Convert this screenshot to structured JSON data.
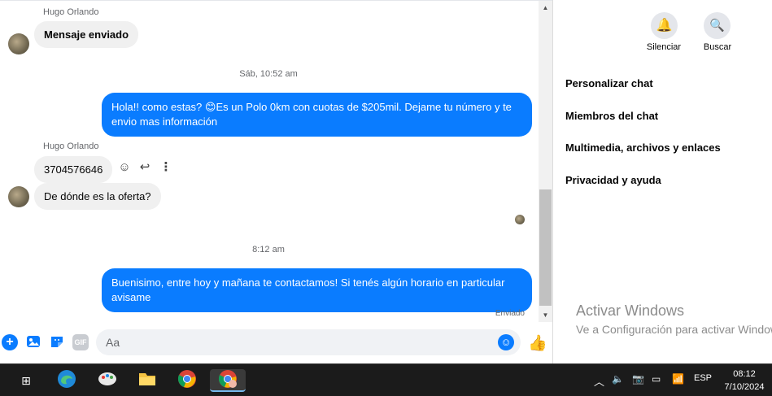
{
  "chat": {
    "sender_top": "Hugo Orlando",
    "msg_enviado": "Mensaje enviado",
    "time1": "Sáb, 10:52 am",
    "out1": "Hola!! como estas? 😊Es un Polo 0km con cuotas de $205mil. Dejame tu número y te envio mas información",
    "sender_mid": "Hugo Orlando",
    "in_number": "3704576646",
    "in_question": "De dónde es la oferta?",
    "time2": "8:12 am",
    "out2": "Buenisimo, entre hoy y mañana te contactamos! Si tenés algún horario en particular avisame",
    "status": "Enviado"
  },
  "composer": {
    "placeholder": "Aa",
    "tools": [
      "plus-icon",
      "image-icon",
      "sticker-icon",
      "gif-icon"
    ]
  },
  "side": {
    "silence": "Silenciar",
    "search": "Buscar",
    "menu": [
      "Personalizar chat",
      "Miembros del chat",
      "Multimedia, archivos y enlaces",
      "Privacidad y ayuda"
    ]
  },
  "watermark": {
    "title": "Activar Windows",
    "subtitle": "Ve a Configuración para activar Windows."
  },
  "taskbar": {
    "lang": "ESP",
    "time": "08:12",
    "date": "7/10/2024"
  },
  "colors": {
    "accent": "#0a7cff",
    "bubble_in": "#f0f0f0",
    "taskbar": "#1b1b1b"
  }
}
